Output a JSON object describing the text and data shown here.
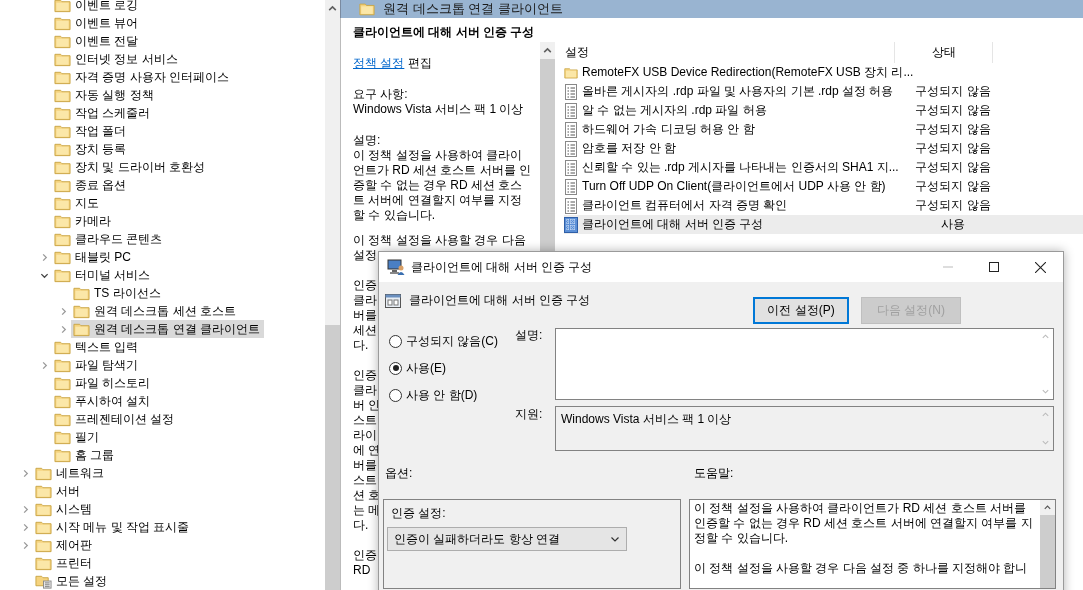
{
  "tree": {
    "continued_items": [
      {
        "label": "이벤트 로깅",
        "selected": false
      },
      {
        "label": "이벤트 뷰어",
        "selected": false
      },
      {
        "label": "이벤트 전달",
        "selected": false
      },
      {
        "label": "인터넷 정보 서비스",
        "selected": false
      },
      {
        "label": "자격 증명 사용자 인터페이스",
        "selected": false
      },
      {
        "label": "자동 실행 정책",
        "selected": false
      },
      {
        "label": "작업 스케줄러",
        "selected": false
      },
      {
        "label": "작업 폴더",
        "selected": false
      },
      {
        "label": "장치 등록",
        "selected": false
      },
      {
        "label": "장치 및 드라이버 호환성",
        "selected": false
      },
      {
        "label": "종료 옵션",
        "selected": false
      },
      {
        "label": "지도",
        "selected": false
      },
      {
        "label": "카메라",
        "selected": false
      },
      {
        "label": "클라우드 콘텐츠",
        "selected": false
      },
      {
        "label": "태블릿 PC",
        "expanded": false,
        "selected": false
      },
      {
        "label": "터미널 서비스",
        "expanded": true,
        "selected": false,
        "children": [
          {
            "label": "TS 라이선스",
            "selected": false
          },
          {
            "label": "원격 데스크톱 세션 호스트",
            "expanded": false,
            "selected": false
          },
          {
            "label": "원격 데스크톱 연결 클라이언트",
            "expanded": false,
            "selected": true
          }
        ]
      },
      {
        "label": "텍스트 입력",
        "selected": false
      },
      {
        "label": "파일 탐색기",
        "expanded": false,
        "selected": false
      },
      {
        "label": "파일 히스토리",
        "selected": false
      },
      {
        "label": "푸시하여 설치",
        "selected": false
      },
      {
        "label": "프레젠테이션 설정",
        "selected": false
      },
      {
        "label": "필기",
        "selected": false
      },
      {
        "label": "홈 그룹",
        "selected": false
      }
    ],
    "items": [
      {
        "label": "네트워크",
        "kind": "folder",
        "expanded": false,
        "selected": false
      },
      {
        "label": "서버",
        "kind": "folder",
        "selected": false
      },
      {
        "label": "시스템",
        "kind": "folder",
        "expanded": false,
        "selected": false
      },
      {
        "label": "시작 메뉴 및 작업 표시줄",
        "kind": "folder",
        "expanded": false,
        "selected": false
      },
      {
        "label": "제어판",
        "kind": "folder",
        "expanded": false,
        "selected": false
      },
      {
        "label": "프린터",
        "kind": "folder",
        "selected": false
      },
      {
        "label": "모든 설정",
        "kind": "settings",
        "selected": false
      }
    ]
  },
  "header": {
    "title": "원격 데스크톱 연결 클라이언트"
  },
  "description_pane": {
    "title": "클라이언트에 대해 서버 인증 구성",
    "link": "정책 설정",
    "link_suffix": "편집",
    "requirements_label": "요구 사항:",
    "requirements": "Windows Vista 서비스 팩 1 이상",
    "description_label": "설명:",
    "description": "이 정책 설정을 사용하여 클라이언트가 RD 세션 호스트 서버를 인증할 수 없는 경우 RD 세션 호스트 서버에 연결할지 여부를 지정할 수 있습니다.",
    "partial_paragraphs": [
      [
        "이 정책 설정을 사용할 경우 다음",
        "설정"
      ],
      [
        "인증",
        "클라",
        "버를",
        "세션",
        "다."
      ],
      [
        "인증",
        "클라",
        "버 인",
        "스트",
        "라이",
        "에 연",
        "버를",
        "스트",
        "션 호",
        "는 메",
        "다."
      ],
      [
        "인증",
        "RD"
      ]
    ]
  },
  "list": {
    "columns": [
      "설정",
      "상태"
    ],
    "rows": [
      {
        "kind": "folder",
        "name": "RemoteFX USB Device Redirection(RemoteFX USB 장치 리...",
        "selected": false
      },
      {
        "kind": "setting",
        "name": "올바른 게시자의 .rdp 파일 및 사용자의 기본 .rdp 설정 허용",
        "state": "구성되지 않음",
        "selected": false
      },
      {
        "kind": "setting",
        "name": "알 수 없는 게시자의 .rdp 파일 허용",
        "state": "구성되지 않음",
        "selected": false
      },
      {
        "kind": "setting",
        "name": "하드웨어 가속 디코딩 허용 안 함",
        "state": "구성되지 않음",
        "selected": false
      },
      {
        "kind": "setting",
        "name": "암호를 저장 안 함",
        "state": "구성되지 않음",
        "selected": false
      },
      {
        "kind": "setting",
        "name": "신뢰할 수 있는 .rdp 게시자를 나타내는 인증서의 SHA1 지...",
        "state": "구성되지 않음",
        "selected": false
      },
      {
        "kind": "setting",
        "name": "Turn Off UDP On Client(클라이언트에서 UDP 사용 안 함)",
        "state": "구성되지 않음",
        "selected": false
      },
      {
        "kind": "setting",
        "name": "클라이언트 컴퓨터에서 자격 증명 확인",
        "state": "구성되지 않음",
        "selected": false
      },
      {
        "kind": "setting_enabled",
        "name": "클라이언트에 대해 서버 인증 구성",
        "state": "사용",
        "selected": true
      }
    ]
  },
  "dialog": {
    "title": "클라이언트에 대해 서버 인증 구성",
    "subtitle": "클라이언트에 대해 서버 인증 구성",
    "buttons": [
      {
        "label": "이전 설정(P)",
        "focused": true,
        "disabled": false
      },
      {
        "label": "다음 설정(N)",
        "focused": false,
        "disabled": true
      }
    ],
    "radios": [
      {
        "label": "구성되지 않음(C)",
        "selected": false
      },
      {
        "label": "사용(E)",
        "selected": true
      },
      {
        "label": "사용 안 함(D)",
        "selected": false
      }
    ],
    "comment_label": "설명:",
    "support_label": "지원:",
    "support_value": "Windows Vista 서비스 팩 1 이상",
    "options_label": "옵션:",
    "help_label": "도움말:",
    "option": {
      "label": "인증 설정:",
      "value": "인증이 실패하더라도 항상 연결"
    },
    "help": [
      "이 정책 설정을 사용하여 클라이언트가 RD 세션 호스트 서버를 인증할 수 없는 경우 RD 세션 호스트 서버에 연결할지 여부를 지정할 수 있습니다.",
      "이 정책 설정을 사용할 경우 다음 설정 중 하나를 지정해야 합니"
    ]
  }
}
